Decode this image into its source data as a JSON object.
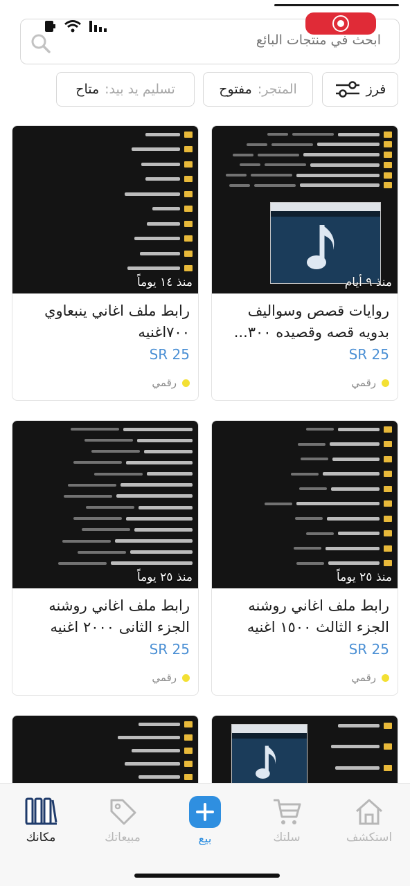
{
  "search": {
    "placeholder": "ابحث في منتجات البائع"
  },
  "filters": {
    "sort_label": "فرز",
    "store_key": "المتجر:",
    "store_value": "مفتوح",
    "delivery_key": "تسليم يد بيد:",
    "delivery_value": "متاح"
  },
  "products": [
    {
      "title": "روايات قصص وسواليف بدويه قصه وقصيده ٣٠٠...",
      "price": "25 SR",
      "kind": "رقمي",
      "age": "منذ ٩ أيام"
    },
    {
      "title": "رابط ملف اغاني ينبعاوي ٧٠٠اغنيه",
      "price": "25 SR",
      "kind": "رقمي",
      "age": "منذ ١٤ يوماً"
    },
    {
      "title": "رابط ملف اغاني روشنه الجزء الثالث ١٥٠٠ اغنيه",
      "price": "25 SR",
      "kind": "رقمي",
      "age": "منذ ٢٥ يوماً"
    },
    {
      "title": "رابط ملف اغاني روشنه الجزء الثانى ٢٠٠٠ اغنيه",
      "price": "25 SR",
      "kind": "رقمي",
      "age": "منذ ٢٥ يوماً"
    }
  ],
  "nav": {
    "explore": "استكشف",
    "cart": "سلتك",
    "sell": "بيع",
    "sales": "مبيعاتك",
    "shelf": "مكانك"
  },
  "icons": {
    "search": "search-icon",
    "sort": "sliders-icon",
    "explore": "home-icon",
    "cart": "cart-icon",
    "sell": "plus-icon",
    "sales": "tag-icon",
    "shelf": "books-icon"
  },
  "colors": {
    "accent": "#2f8fe0",
    "price": "#4a8fd4",
    "record": "#e02b37",
    "digital_dot": "#f3e033"
  }
}
